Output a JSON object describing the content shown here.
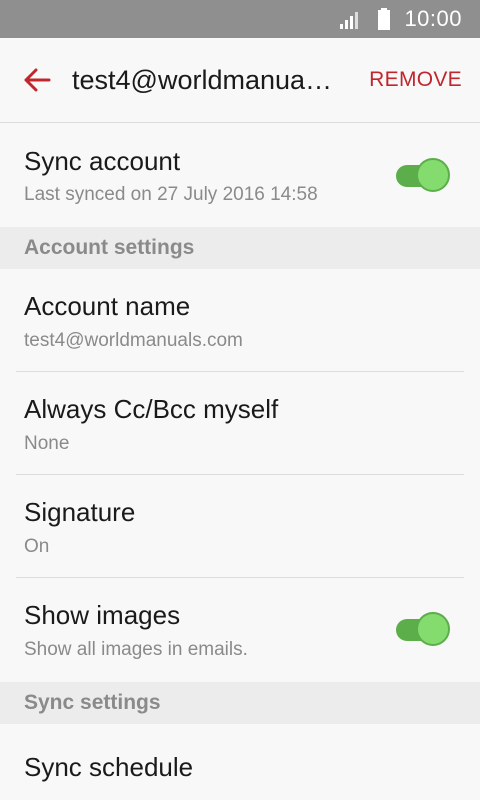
{
  "status_bar": {
    "time": "10:00"
  },
  "app_bar": {
    "title": "test4@worldmanua…",
    "remove_label": "REMOVE"
  },
  "sync_account": {
    "title": "Sync account",
    "subtitle": "Last synced on 27 July 2016  14:58",
    "enabled": true
  },
  "account_settings": {
    "header": "Account settings",
    "items": [
      {
        "title": "Account name",
        "subtitle": "test4@worldmanuals.com"
      },
      {
        "title": "Always Cc/Bcc myself",
        "subtitle": "None"
      },
      {
        "title": "Signature",
        "subtitle": "On"
      },
      {
        "title": "Show images",
        "subtitle": "Show all images in emails.",
        "enabled": true
      }
    ]
  },
  "sync_settings": {
    "header": "Sync settings",
    "items": [
      {
        "title": "Sync schedule"
      }
    ]
  },
  "colors": {
    "accent": "#c0272d",
    "toggle_on": "#84db6e",
    "status_bar": "#8f8f8f"
  }
}
